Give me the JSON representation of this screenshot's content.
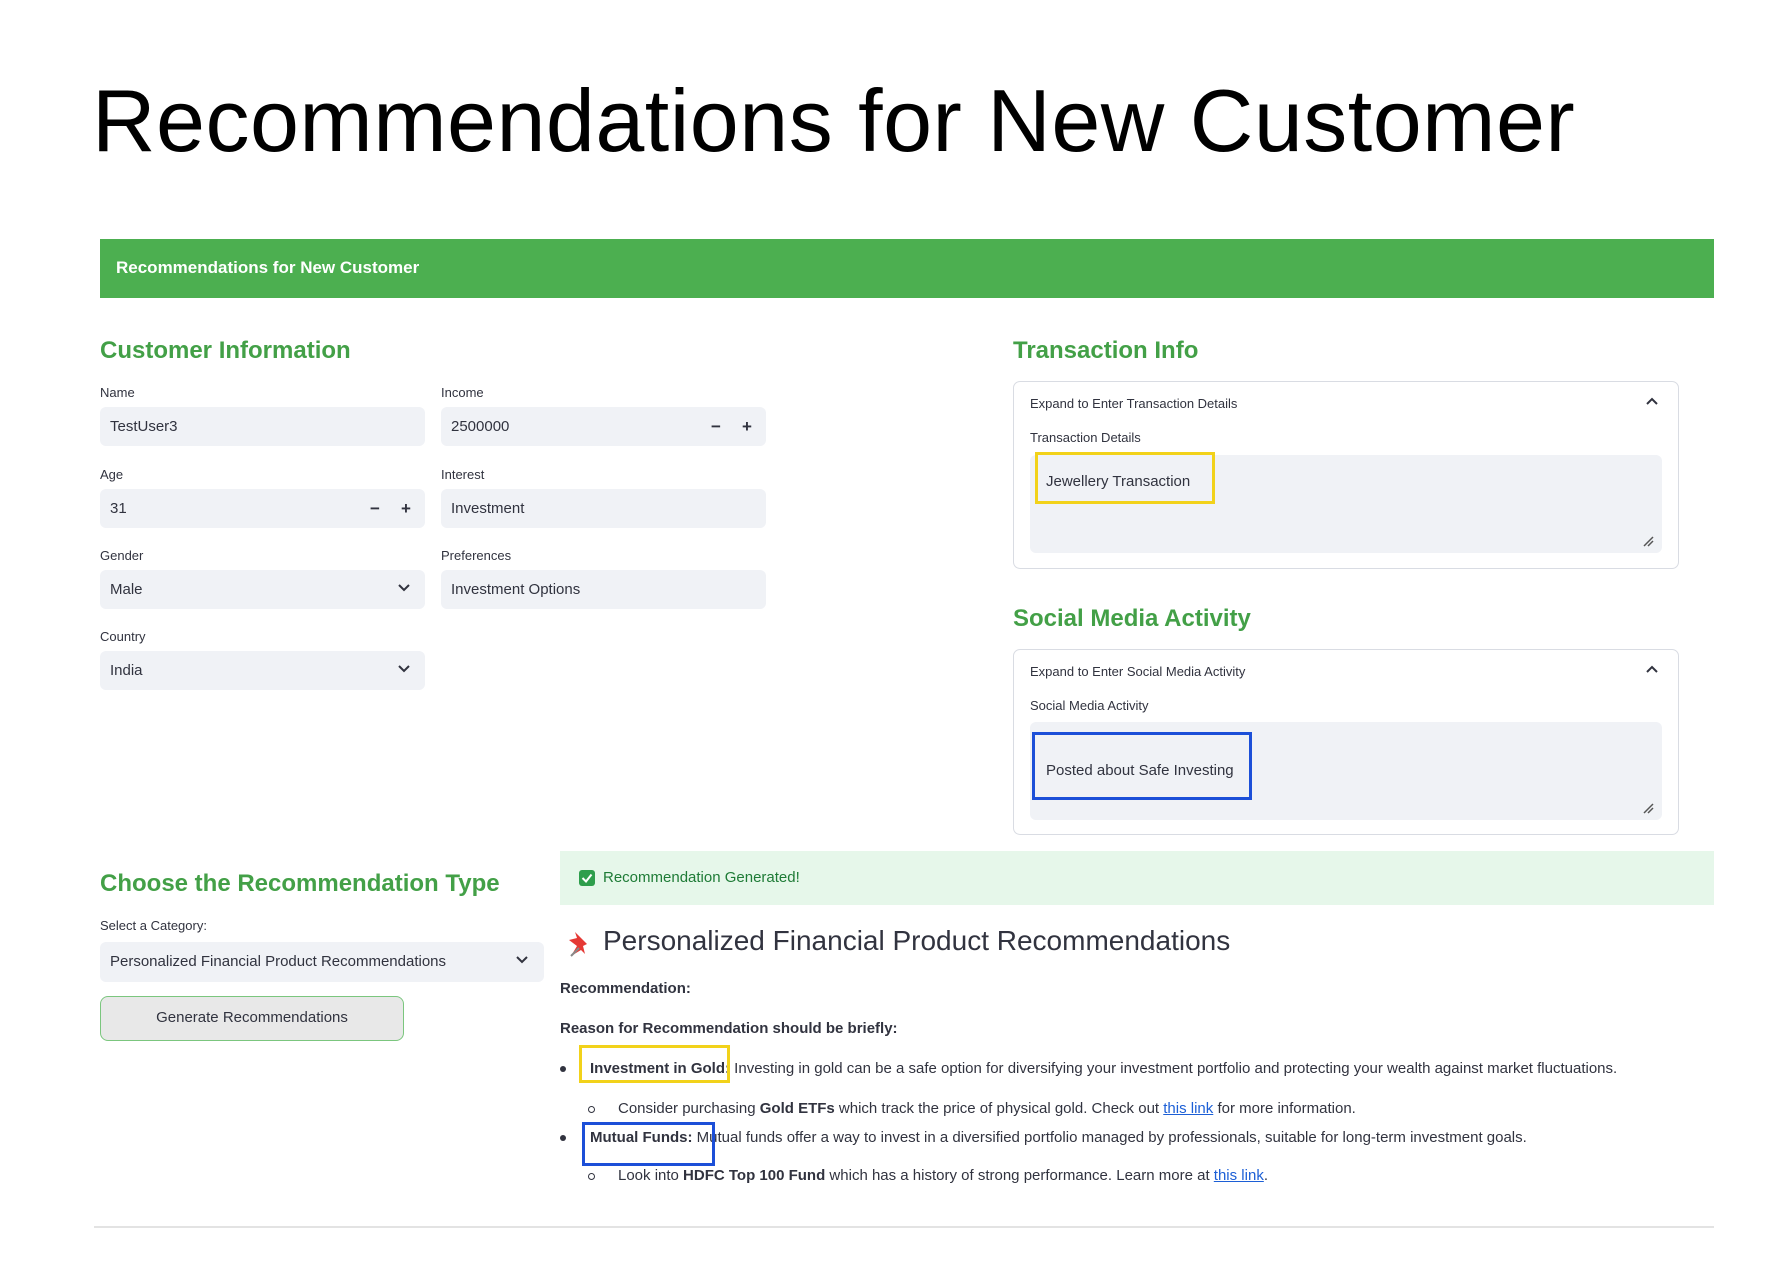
{
  "slide_title": "Recommendations for New Customer",
  "app_header": "Recommendations for New Customer",
  "customer_info": {
    "title": "Customer Information",
    "name_label": "Name",
    "name_value": "TestUser3",
    "income_label": "Income",
    "income_value": "2500000",
    "age_label": "Age",
    "age_value": "31",
    "interest_label": "Interest",
    "interest_value": "Investment",
    "gender_label": "Gender",
    "gender_value": "Male",
    "preferences_label": "Preferences",
    "preferences_value": "Investment Options",
    "country_label": "Country",
    "country_value": "India",
    "minus": "−",
    "plus": "+"
  },
  "transaction": {
    "title": "Transaction Info",
    "expander_title": "Expand to Enter Transaction Details",
    "field_label": "Transaction Details",
    "value": "Jewellery Transaction"
  },
  "social": {
    "title": "Social Media Activity",
    "expander_title": "Expand to Enter Social Media Activity",
    "field_label": "Social Media Activity",
    "value": "Posted about Safe Investing"
  },
  "choose": {
    "title": "Choose the Recommendation Type",
    "select_label": "Select a Category:",
    "select_value": "Personalized Financial Product Recommendations",
    "button_label": "Generate Recommendations"
  },
  "result": {
    "success": "Recommendation Generated!",
    "heading": "Personalized Financial Product Recommendations",
    "rec_label": "Recommendation:",
    "reason_label": "Reason for Recommendation should be briefly:",
    "item1_title": "Investment in Gold:",
    "item1_text": " Investing in gold can be a safe option for diversifying your investment portfolio and protecting your wealth against market fluctuations.",
    "item1_sub_pre": "Consider purchasing ",
    "item1_sub_bold": "Gold ETFs",
    "item1_sub_mid": " which track the price of physical gold. Check out ",
    "item1_sub_link": "this link",
    "item1_sub_post": " for more information.",
    "item2_title": "Mutual Funds:",
    "item2_text": " Mutual funds offer a way to invest in a diversified portfolio managed by professionals, suitable for long-term investment goals.",
    "item2_sub_pre": "Look into ",
    "item2_sub_bold": "HDFC Top 100 Fund",
    "item2_sub_mid": " which has a history of strong performance. Learn more at ",
    "item2_sub_link": "this link",
    "item2_sub_post": "."
  },
  "colors": {
    "header_green": "#4caf50",
    "section_green": "#43a047",
    "highlight_yellow": "#f2d21a",
    "highlight_blue": "#1c4fd8",
    "success_bg": "#e6f7ea",
    "link_blue": "#1c5fd6"
  },
  "icons": [
    "pushpin-icon",
    "checkbox-icon",
    "chevron-down-icon",
    "chevron-up-icon",
    "resize-grip-icon"
  ]
}
